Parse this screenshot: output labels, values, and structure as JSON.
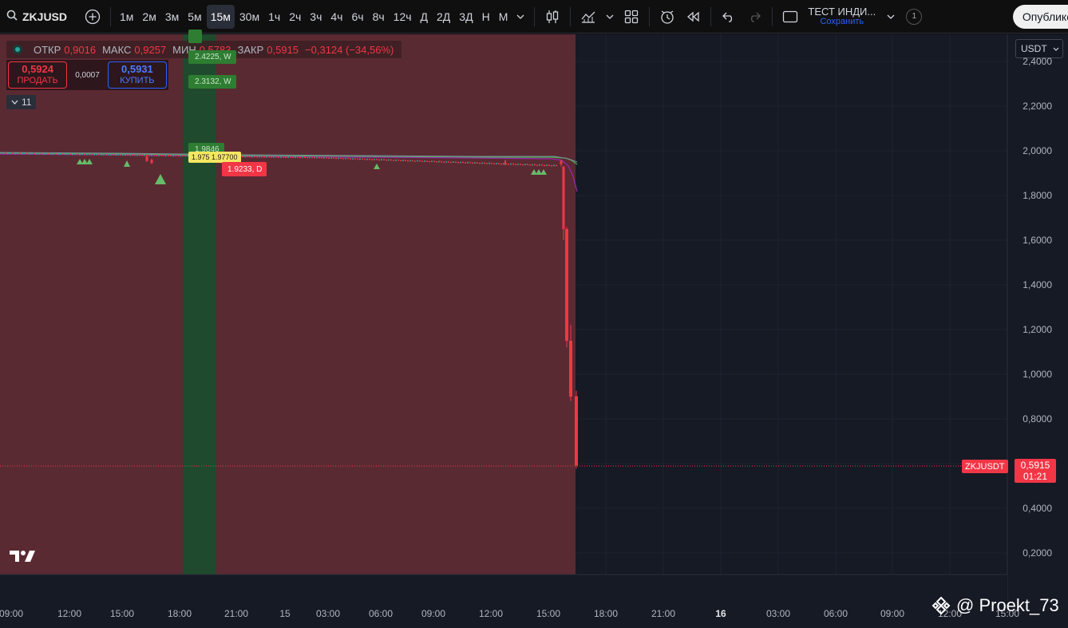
{
  "toolbar": {
    "symbol": "ZKJUSD",
    "intervals": [
      "1м",
      "2м",
      "3м",
      "5м",
      "15м",
      "30м",
      "1ч",
      "2ч",
      "3ч",
      "4ч",
      "6ч",
      "8ч",
      "12ч",
      "Д",
      "2Д",
      "3Д",
      "Н",
      "М"
    ],
    "active_interval": "15м",
    "layout_title": "ТЕСТ ИНДИ...",
    "layout_save": "Сохранить",
    "layout_count": "1",
    "publish_label": "Опублико"
  },
  "legend": {
    "open_label": "ОТКР",
    "open_value": "0,9016",
    "high_label": "МАКС",
    "high_value": "0,9257",
    "low_label": "МИН",
    "low_value": "0,5783",
    "close_label": "ЗАКР",
    "close_value": "0,5915",
    "change": "−0,3124 (−34,56%)"
  },
  "trade": {
    "sell_price": "0,5924",
    "sell_label": "ПРОДАТЬ",
    "spread": "0,0007",
    "buy_price": "0,5931",
    "buy_label": "КУПИТЬ"
  },
  "indicators_collapsed": {
    "count": "11"
  },
  "currency": "USDT",
  "y_axis": {
    "ticks": [
      "2,4000",
      "2,2000",
      "2,0000",
      "1,8000",
      "1,6000",
      "1,4000",
      "1,2000",
      "1,0000",
      "0,8000",
      "0,6000",
      "0,4000",
      "0,2000"
    ]
  },
  "x_axis": {
    "ticks": [
      "09:00",
      "12:00",
      "15:00",
      "18:00",
      "21:00",
      "15",
      "03:00",
      "06:00",
      "09:00",
      "12:00",
      "15:00",
      "18:00",
      "21:00",
      "16",
      "03:00",
      "06:00",
      "09:00",
      "12:00",
      "15:00"
    ]
  },
  "last_price": {
    "symbol": "ZKJUSDT",
    "price": "0,5915",
    "countdown": "01:21"
  },
  "tags": {
    "green_1": "2.4225, W",
    "green_2": "2.3132, W",
    "green_3": "1.9846",
    "yellow_1": "1.975 1.97700",
    "red_1": "1.9233, D"
  },
  "watermark": "@ Proekt_73",
  "colors": {
    "bull": "#26a69a",
    "bear": "#f23645",
    "accent": "#2962ff",
    "green_zone": "#2e7d32",
    "red_zone": "#6b2b33"
  },
  "chart_data": {
    "type": "candlestick",
    "symbol": "ZKJUSDT",
    "interval": "15m",
    "ylim": [
      0.1,
      2.5
    ],
    "series": [
      {
        "name": "price",
        "approx_path": [
          [
            0,
            1.99
          ],
          [
            120,
            1.985
          ],
          [
            240,
            1.98
          ],
          [
            400,
            1.975
          ],
          [
            600,
            1.96
          ],
          [
            690,
            1.96
          ],
          [
            705,
            1.92
          ],
          [
            710,
            1.65
          ],
          [
            715,
            1.15
          ],
          [
            720,
            0.9
          ],
          [
            723,
            0.5915
          ]
        ]
      }
    ],
    "last": 0.5915
  }
}
